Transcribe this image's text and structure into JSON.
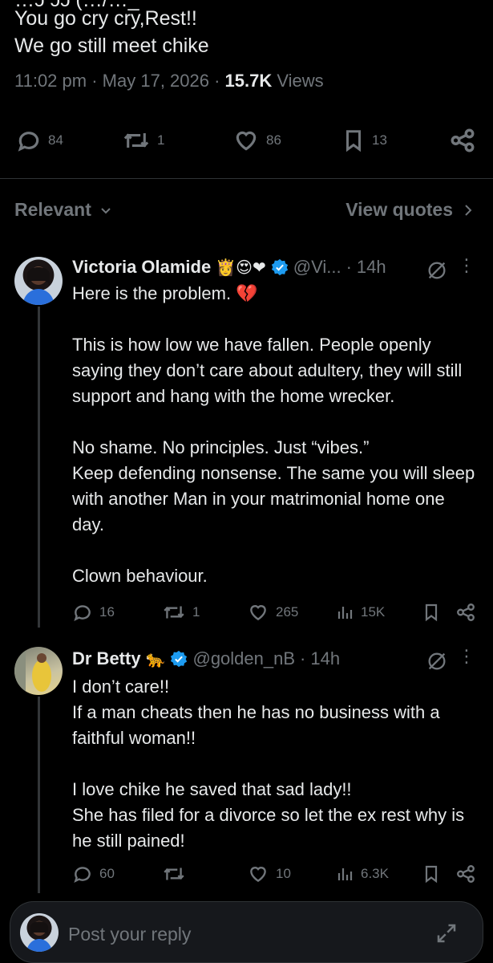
{
  "tweet": {
    "cut_line": "…ɔ ɔɔ (…/…_",
    "text": "You go cry cry,Rest!!\nWe go still meet chike",
    "time": "11:02 pm",
    "date": "May 17, 2026",
    "views_count": "15.7K",
    "views_label": "Views",
    "stats": {
      "replies": "84",
      "reposts": "1",
      "likes": "86",
      "bookmarks": "13"
    }
  },
  "sort": {
    "label": "Relevant",
    "quotes": "View quotes"
  },
  "replies": [
    {
      "name": "Victoria Olamide",
      "emojis": "👸😍❤",
      "handle": "@Vi...",
      "age": "14h",
      "paragraphs": [
        "Here is the problem. 💔",
        "This is how low we have fallen. People openly saying they don’t care about adultery, they will still support and hang with the home wrecker.",
        "No shame. No principles. Just “vibes.”\nKeep defending nonsense. The same you will sleep with another Man in your matrimonial home one day.",
        "Clown behaviour."
      ],
      "stats": {
        "replies": "16",
        "reposts": "1",
        "likes": "265",
        "views": "15K"
      }
    },
    {
      "name": "Dr Betty",
      "emojis": "🐆",
      "handle": "@golden_nB",
      "age": "14h",
      "paragraphs": [
        "I don’t care!!\nIf a man cheats then he has no business with a faithful woman!!",
        "I love chike he saved that sad lady!!\nShe has filed for a divorce so let the ex rest why is he still pained!"
      ],
      "stats": {
        "replies": "60",
        "reposts": "",
        "likes": "10",
        "views": "6.3K"
      }
    }
  ],
  "composer": {
    "placeholder": "Post your reply"
  },
  "colors": {
    "accent": "#1d9bf0",
    "muted": "#71767b",
    "background": "#000000"
  }
}
